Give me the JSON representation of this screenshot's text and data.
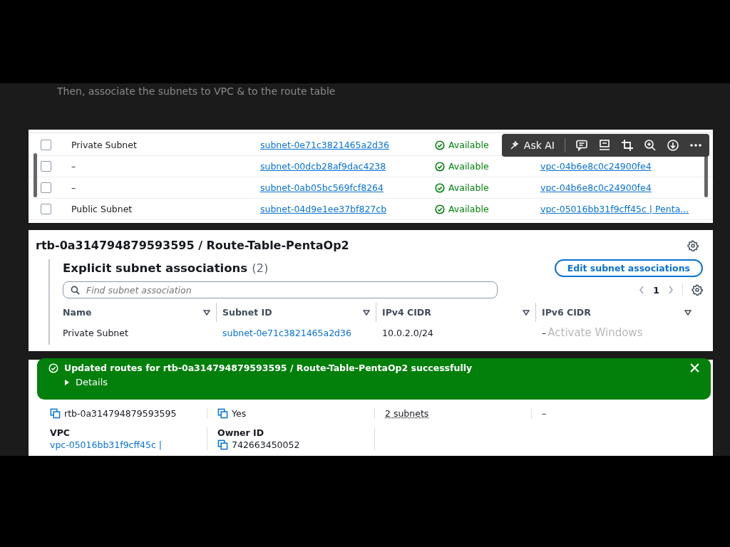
{
  "caption": "Then, associate the subnets to VPC & to the route table",
  "subnet_table": {
    "rows": [
      {
        "checked": false,
        "name": "Private Subnet",
        "subnet_id": "subnet-0e71c3821465a2d36",
        "state": "Available"
      },
      {
        "checked": false,
        "name": "–",
        "subnet_id": "subnet-00dcb28af9dac4238",
        "state": "Available",
        "vpc": "vpc-04b6e8c0c24900fe4"
      },
      {
        "checked": false,
        "name": "–",
        "subnet_id": "subnet-0ab05bc569fcf8264",
        "state": "Available",
        "vpc": "vpc-04b6e8c0c24900fe4"
      },
      {
        "checked": false,
        "name": "Public Subnet",
        "subnet_id": "subnet-04d9e1ee37bf827cb",
        "state": "Available",
        "vpc": "vpc-05016bb31f9cff45c | Penta..."
      }
    ]
  },
  "image_toolbar": {
    "ask_ai": "Ask AI"
  },
  "route_table": {
    "title": "rtb-0a314794879593595 / Route-Table-PentaOp2",
    "section_title": "Explicit subnet associations",
    "count": "(2)",
    "edit_button": "Edit subnet associations",
    "search": {
      "placeholder": "Find subnet association"
    },
    "page": "1",
    "columns": [
      "Name",
      "Subnet ID",
      "IPv4 CIDR",
      "IPv6 CIDR"
    ],
    "rows": [
      {
        "name": "Private Subnet",
        "subnet_id": "subnet-0e71c3821465a2d36",
        "ipv4": "10.0.2.0/24",
        "ipv6": "–"
      }
    ]
  },
  "os_watermark": "Activate Windows",
  "flash": {
    "message": "Updated routes for rtb-0a314794879593595 / Route-Table-PentaOp2 successfully",
    "details": "Details",
    "expanded": false
  },
  "details": {
    "fields": [
      {
        "kind": "copy",
        "value": "rtb-0a314794879593595"
      },
      {
        "kind": "copy",
        "value": "Yes"
      },
      {
        "kind": "link",
        "value": "2 subnets"
      },
      {
        "kind": "text",
        "value": "–"
      },
      {
        "kind": "link",
        "label": "VPC",
        "value": "vpc-05016bb31f9cff45c |"
      },
      {
        "kind": "copy",
        "label": "Owner ID",
        "value": "742663450052"
      }
    ]
  }
}
